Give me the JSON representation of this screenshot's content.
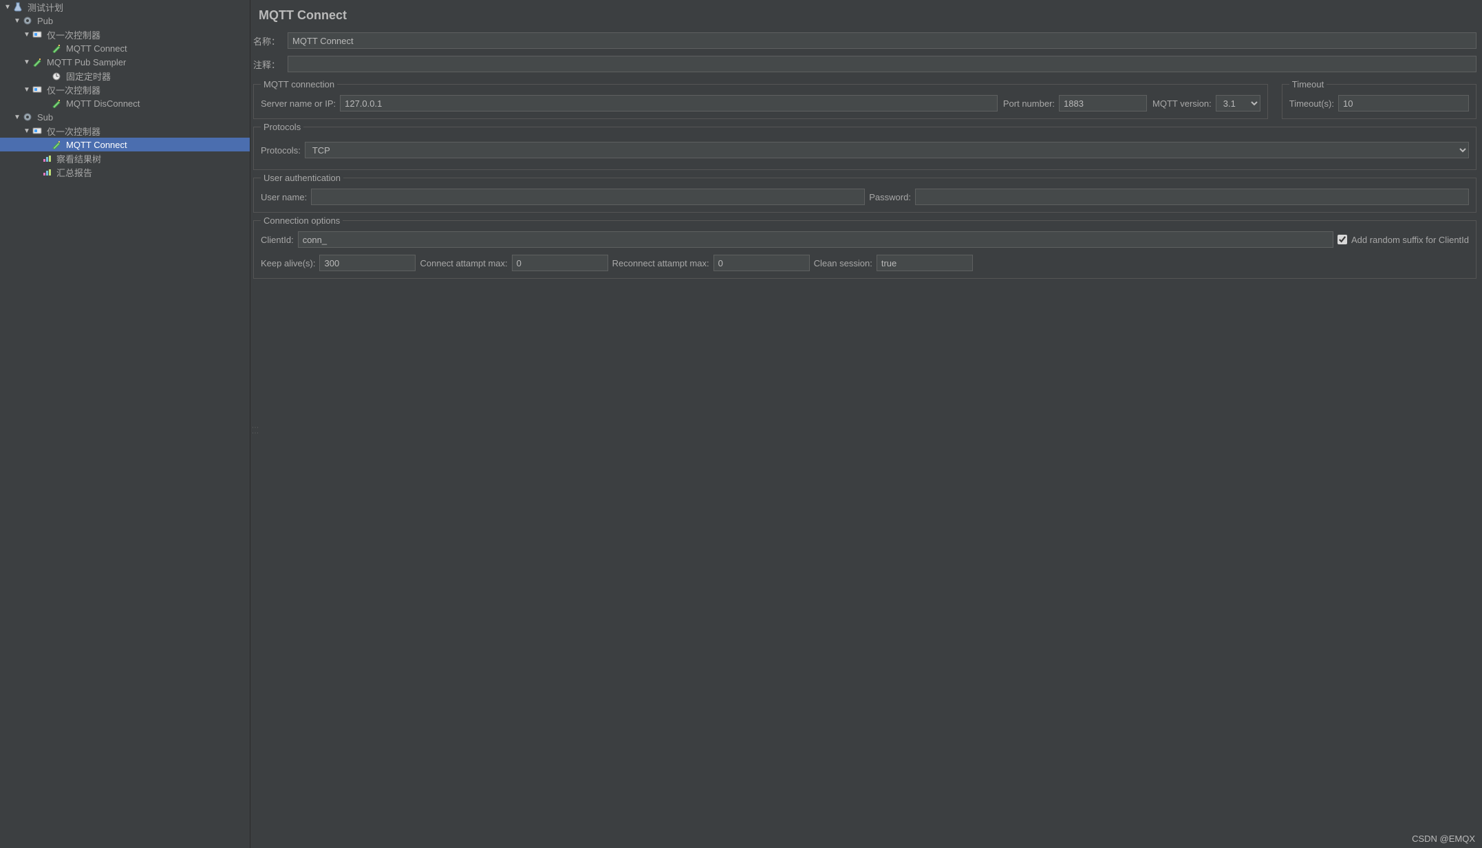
{
  "tree": {
    "root": "测试计划",
    "pub": "Pub",
    "pub_once1": "仅一次控制器",
    "pub_connect": "MQTT Connect",
    "pub_sampler": "MQTT Pub Sampler",
    "pub_timer": "固定定时器",
    "pub_once2": "仅一次控制器",
    "pub_disconnect": "MQTT DisConnect",
    "sub": "Sub",
    "sub_once1": "仅一次控制器",
    "sub_connect": "MQTT Connect",
    "view_tree": "察看结果树",
    "summary": "汇总报告"
  },
  "header": {
    "title": "MQTT Connect",
    "name_label": "名称：",
    "name_value": "MQTT Connect",
    "comment_label": "注释：",
    "comment_value": ""
  },
  "mqtt_conn": {
    "legend": "MQTT connection",
    "server_label": "Server name or IP:",
    "server_value": "127.0.0.1",
    "port_label": "Port number:",
    "port_value": "1883",
    "version_label": "MQTT version:",
    "version_value": "3.1"
  },
  "timeout": {
    "legend": "Timeout",
    "label": "Timeout(s):",
    "value": "10"
  },
  "protocols": {
    "legend": "Protocols",
    "label": "Protocols:",
    "value": "TCP"
  },
  "auth": {
    "legend": "User authentication",
    "user_label": "User name:",
    "user_value": "",
    "pass_label": "Password:",
    "pass_value": ""
  },
  "conn_opts": {
    "legend": "Connection options",
    "clientid_label": "ClientId:",
    "clientid_value": "conn_",
    "random_suffix_label": "Add random suffix for ClientId",
    "random_suffix_checked": true,
    "keepalive_label": "Keep alive(s):",
    "keepalive_value": "300",
    "conn_attempt_label": "Connect attampt max:",
    "conn_attempt_value": "0",
    "reconn_attempt_label": "Reconnect attampt max:",
    "reconn_attempt_value": "0",
    "clean_label": "Clean session:",
    "clean_value": "true"
  },
  "watermark": "CSDN @EMQX"
}
